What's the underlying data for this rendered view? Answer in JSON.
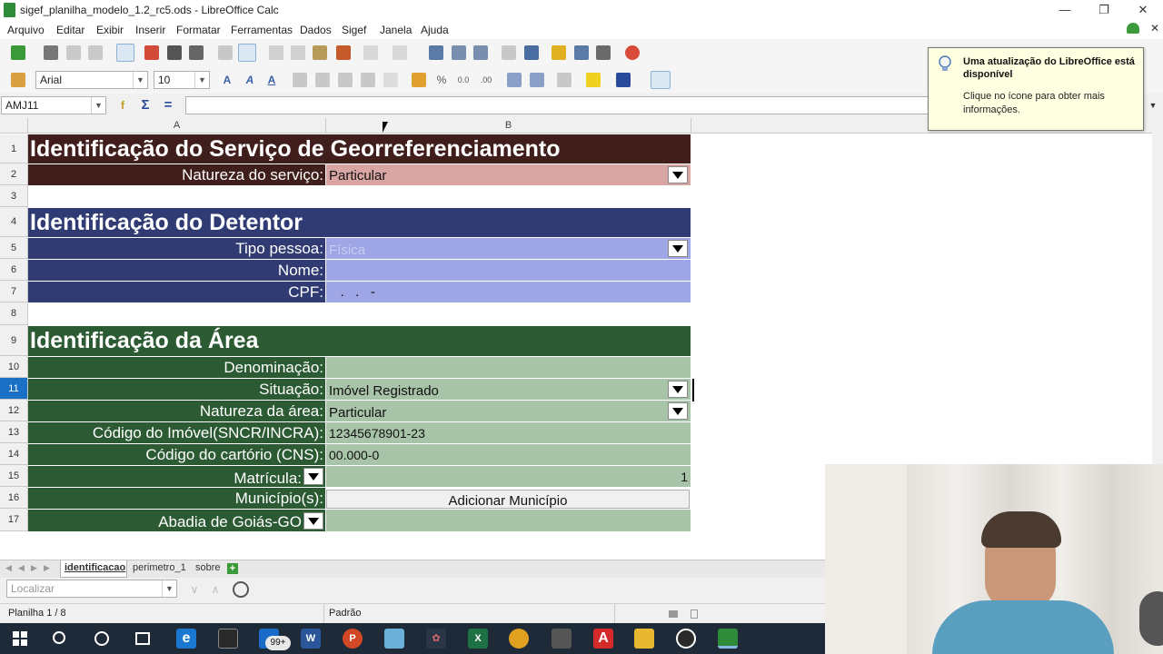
{
  "window": {
    "title": "sigef_planilha_modelo_1.2_rc5.ods - LibreOffice Calc"
  },
  "menu": [
    "Arquivo",
    "Editar",
    "Exibir",
    "Inserir",
    "Formatar",
    "Ferramentas",
    "Dados",
    "Sigef",
    "Janela",
    "Ajuda"
  ],
  "format_toolbar": {
    "font_name": "Arial",
    "font_size": "10"
  },
  "formula_bar": {
    "name_box": "AMJ11",
    "content": ""
  },
  "notification": {
    "title": "Uma atualização do LibreOffice está disponível",
    "body": "Clique no ícone para obter mais informações."
  },
  "columns": [
    "A",
    "B"
  ],
  "rows": {
    "r1": {
      "num": "1",
      "text": "Identificação do Serviço de Georreferenciamento"
    },
    "r2": {
      "num": "2",
      "label": "Natureza do serviço:",
      "value": "Particular"
    },
    "r3": {
      "num": "3"
    },
    "r4": {
      "num": "4",
      "text": "Identificação do Detentor"
    },
    "r5": {
      "num": "5",
      "label": "Tipo pessoa:",
      "value": "Física"
    },
    "r6": {
      "num": "6",
      "label": "Nome:",
      "value": ""
    },
    "r7": {
      "num": "7",
      "label": "CPF:",
      "value": "   .   .   -"
    },
    "r8": {
      "num": "8"
    },
    "r9": {
      "num": "9",
      "text": "Identificação da Área"
    },
    "r10": {
      "num": "10",
      "label": "Denominação:",
      "value": ""
    },
    "r11": {
      "num": "11",
      "label": "Situação:",
      "value": "Imóvel Registrado"
    },
    "r12": {
      "num": "12",
      "label": "Natureza da área:",
      "value": "Particular"
    },
    "r13": {
      "num": "13",
      "label": "Código do Imóvel(SNCR/INCRA):",
      "value": "12345678901-23"
    },
    "r14": {
      "num": "14",
      "label": "Código do cartório (CNS):",
      "value": "00.000-0"
    },
    "r15": {
      "num": "15",
      "label": "Matrícula:",
      "value": "1"
    },
    "r16": {
      "num": "16",
      "label": "Município(s):",
      "button": "Adicionar Município"
    },
    "r17": {
      "num": "17",
      "label": "Abadia de Goiás-GO"
    }
  },
  "sheet_tabs": [
    "identificacao",
    "perimetro_1",
    "sobre"
  ],
  "find": {
    "placeholder": "Localizar"
  },
  "status": {
    "sheet": "Planilha 1 / 8",
    "style": "Padrão"
  },
  "taskbar": {
    "mail_badge": "99+"
  },
  "colors": {
    "dark_red": "#3f1e1c",
    "pink_value": "#d8a5a3",
    "navy": "#2f3b72",
    "lavender_value": "#9ea6e6",
    "forest": "#2b5a33",
    "sage_value": "#a8c4a8"
  }
}
